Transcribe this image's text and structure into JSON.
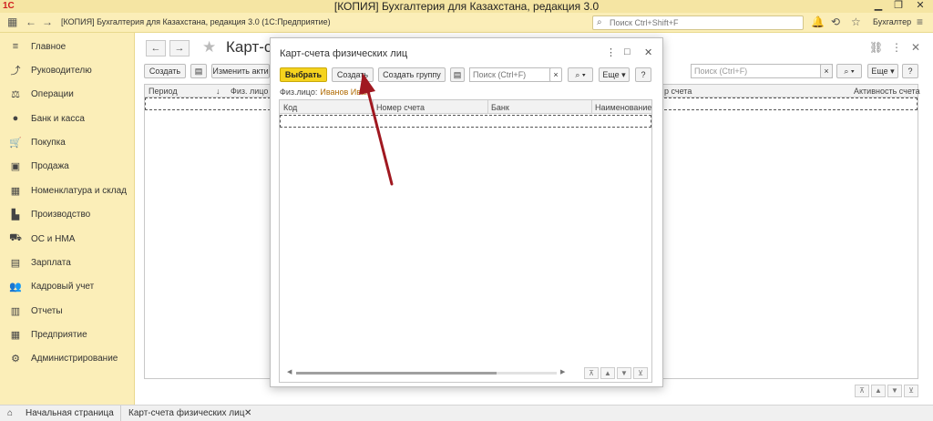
{
  "window": {
    "title": "[КОПИЯ] Бухгалтерия для Казахстана, редакция 3.0",
    "subtitle": "[КОПИЯ] Бухгалтерия для Казахстана, редакция 3.0  (1С:Предприятие)",
    "search_placeholder": "Поиск Ctrl+Shift+F",
    "user": "Бухгалтер"
  },
  "sidebar": {
    "items": [
      {
        "label": "Главное",
        "icon": "menu-icon"
      },
      {
        "label": "Руководителю",
        "icon": "chart-icon"
      },
      {
        "label": "Операции",
        "icon": "operations-icon"
      },
      {
        "label": "Банк и касса",
        "icon": "coin-icon"
      },
      {
        "label": "Покупка",
        "icon": "cart-icon"
      },
      {
        "label": "Продажа",
        "icon": "bag-icon"
      },
      {
        "label": "Номенклатура и склад",
        "icon": "grid-icon"
      },
      {
        "label": "Производство",
        "icon": "factory-icon"
      },
      {
        "label": "ОС и НМА",
        "icon": "truck-icon"
      },
      {
        "label": "Зарплата",
        "icon": "money-icon"
      },
      {
        "label": "Кадровый учет",
        "icon": "people-icon"
      },
      {
        "label": "Отчеты",
        "icon": "report-icon"
      },
      {
        "label": "Предприятие",
        "icon": "building-icon"
      },
      {
        "label": "Администрирование",
        "icon": "gear-icon"
      }
    ]
  },
  "main_form": {
    "title": "Карт-сче",
    "buttons": {
      "create": "Создать",
      "change": "Изменить акти",
      "more": "Еще"
    },
    "search_placeholder": "Поиск (Ctrl+F)",
    "columns": {
      "period": "Период",
      "person": "Физ. лицо",
      "account": "р счета",
      "activity": "Активность счета"
    }
  },
  "dialog": {
    "title": "Карт-счета физических лиц",
    "buttons": {
      "select": "Выбрать",
      "create": "Создать",
      "create_group": "Создать группу",
      "more": "Еще",
      "help": "?"
    },
    "search_placeholder": "Поиск (Ctrl+F)",
    "filter_label": "Физ.лицо:",
    "filter_value": "Иванов Иван",
    "columns": {
      "code": "Код",
      "account_number": "Номер счета",
      "bank": "Банк",
      "name": "Наименование"
    }
  },
  "tabs": {
    "home": "Начальная страница",
    "current": "Карт-счета физических лиц"
  },
  "colors": {
    "accent_yellow": "#f5d31e",
    "sidebar": "#fbeeb8",
    "arrow": "#a01820"
  }
}
